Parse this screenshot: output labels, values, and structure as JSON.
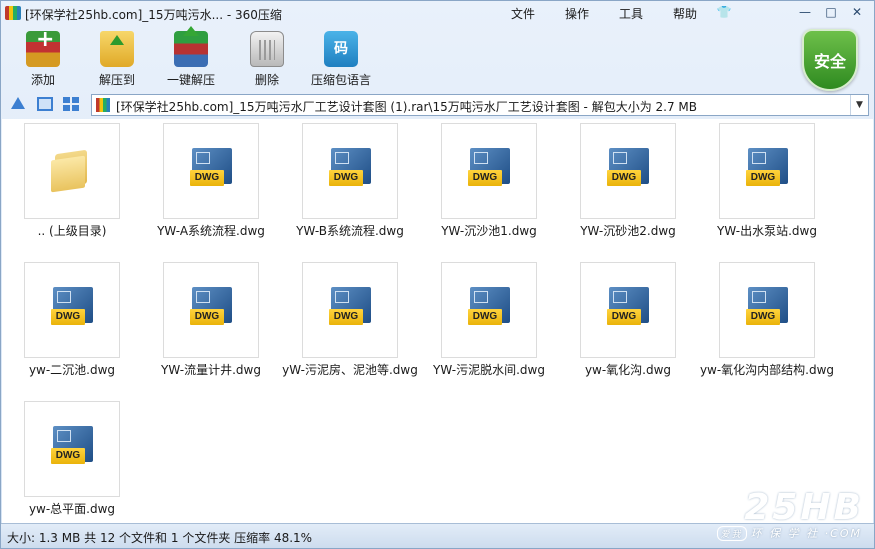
{
  "window": {
    "title": "[环保学社25hb.com]_15万吨污水... - 360压缩"
  },
  "menu": [
    "文件",
    "操作",
    "工具",
    "帮助"
  ],
  "window_controls": {
    "minimize": "—",
    "maximize": "□",
    "close": "✕",
    "skin": "👕"
  },
  "toolbar": {
    "items": [
      {
        "label": "添加",
        "icon": "add-archive-icon"
      },
      {
        "label": "解压到",
        "icon": "extract-to-icon"
      },
      {
        "label": "一键解压",
        "icon": "one-click-extract-icon"
      },
      {
        "label": "删除",
        "icon": "delete-trash-icon"
      },
      {
        "label": "压缩包语言",
        "icon": "archive-language-icon",
        "glyph": "码"
      }
    ],
    "security_label": "安全"
  },
  "address": {
    "path": "[环保学社25hb.com]_15万吨污水厂工艺设计套图 (1).rar\\15万吨污水厂工艺设计套图 - 解包大小为 2.7 MB",
    "dropdown": "▼"
  },
  "files": [
    {
      "name": ".. (上级目录)",
      "type": "folder"
    },
    {
      "name": "YW-A系统流程.dwg",
      "type": "dwg"
    },
    {
      "name": "YW-B系统流程.dwg",
      "type": "dwg"
    },
    {
      "name": "YW-沉沙池1.dwg",
      "type": "dwg"
    },
    {
      "name": "YW-沉砂池2.dwg",
      "type": "dwg"
    },
    {
      "name": "YW-出水泵站.dwg",
      "type": "dwg"
    },
    {
      "name": "yw-二沉池.dwg",
      "type": "dwg"
    },
    {
      "name": "YW-流量计井.dwg",
      "type": "dwg"
    },
    {
      "name": "yW-污泥房、泥池等.dwg",
      "type": "dwg"
    },
    {
      "name": "YW-污泥脱水间.dwg",
      "type": "dwg"
    },
    {
      "name": "yw-氧化沟.dwg",
      "type": "dwg"
    },
    {
      "name": "yw-氧化沟内部结构.dwg",
      "type": "dwg"
    },
    {
      "name": "yw-总平面.dwg",
      "type": "dwg"
    }
  ],
  "dwg_tag": "DWG",
  "status": {
    "text": "大小: 1.3 MB 共 12 个文件和 1 个文件夹 压缩率 48.1%"
  },
  "watermark": {
    "brand": "25HB",
    "badge": "爱我",
    "sub": "环 保 学 社 ·COM"
  }
}
